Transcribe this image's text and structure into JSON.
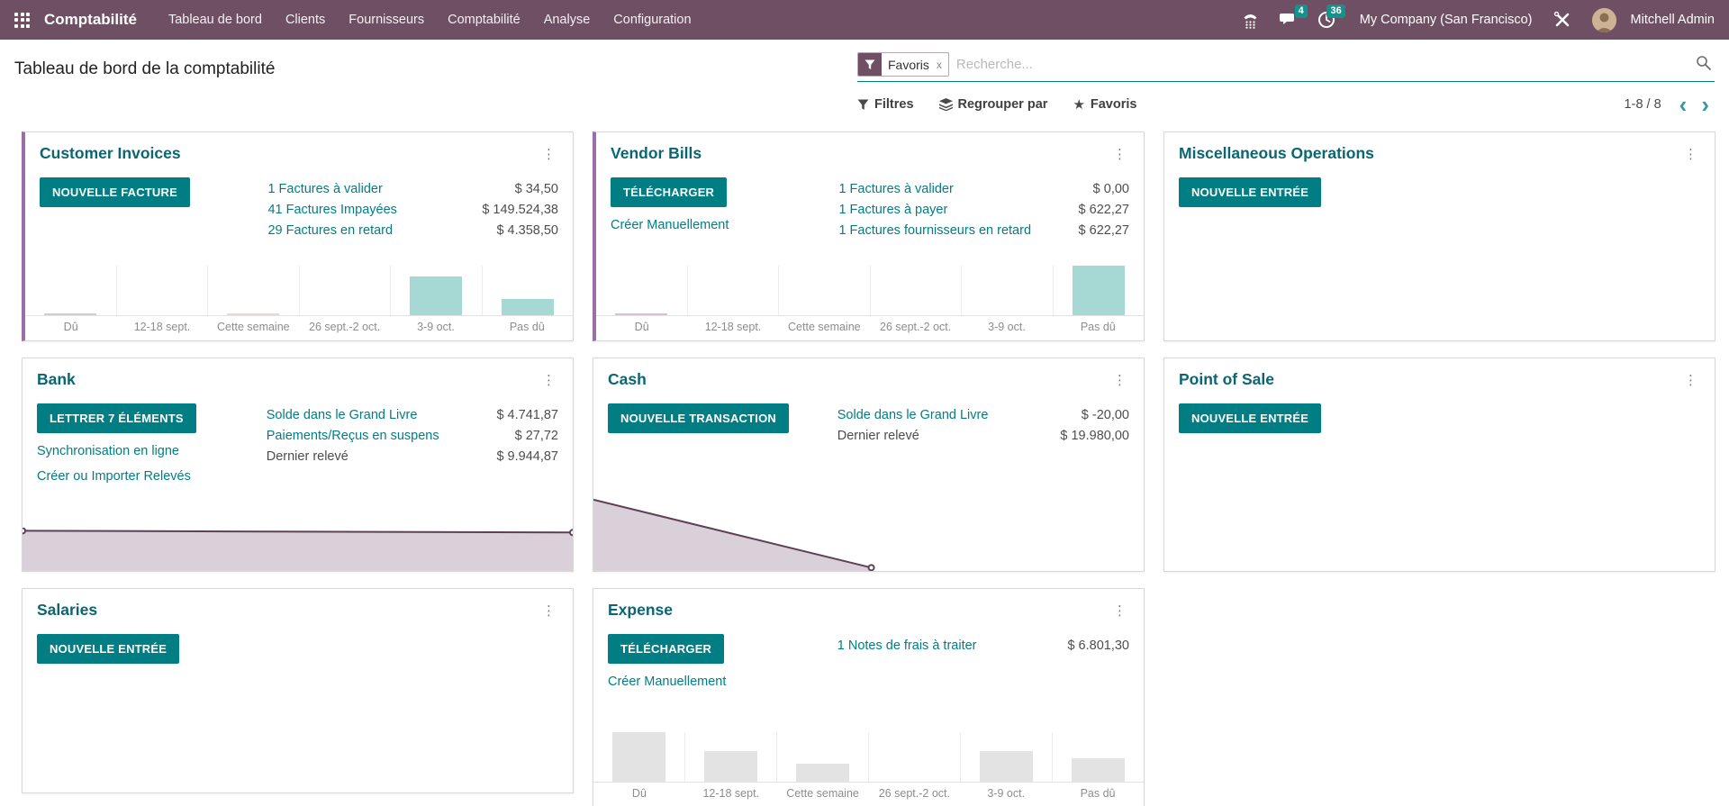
{
  "app": {
    "name": "Comptabilité",
    "menu": [
      "Tableau de bord",
      "Clients",
      "Fournisseurs",
      "Comptabilité",
      "Analyse",
      "Configuration"
    ],
    "systray": {
      "messages_badge": "4",
      "activities_badge": "36",
      "company": "My Company (San Francisco)",
      "user": "Mitchell Admin"
    }
  },
  "page": {
    "title": "Tableau de bord de la comptabilité",
    "search": {
      "facet_label": "Favoris",
      "facet_remove": "x",
      "placeholder": "Recherche..."
    },
    "controls": {
      "filters": "Filtres",
      "group_by": "Regrouper par",
      "favorites": "Favoris"
    },
    "pager": {
      "range": "1-8 / 8",
      "prev": "‹",
      "next": "›"
    }
  },
  "colors": {
    "navbar": "#6e4f64",
    "accent_teal": "#017e84",
    "card_stripe_purple": "#9a6fa8",
    "bar_teal": "#a6d9d4",
    "bar_gray": "#e3e3e3",
    "line_purple": "#5c4156",
    "area_fill": "#d9d0d9"
  },
  "cards": [
    {
      "id": "customer_invoices",
      "title": "Customer Invoices",
      "accent": true,
      "button": "NOUVELLE FACTURE",
      "links": [],
      "stats": [
        {
          "label": "1 Factures à valider",
          "value": "$ 34,50",
          "link": true
        },
        {
          "label": "41 Factures Impayées",
          "value": "$ 149.524,38",
          "link": true
        },
        {
          "label": "29 Factures en retard",
          "value": "$ 4.358,50",
          "link": true
        }
      ],
      "chart": {
        "type": "bar",
        "categories": [
          "Dû",
          "12-18 sept.",
          "Cette semaine",
          "26 sept.-2 oct.",
          "3-9 oct.",
          "Pas dû"
        ],
        "values": [
          0.04,
          0,
          0.02,
          0,
          0.78,
          0.33
        ],
        "bar_colors": [
          "#cfcfcf",
          null,
          "#e9d7d4",
          null,
          "#a6d9d4",
          "#a6d9d4"
        ]
      }
    },
    {
      "id": "vendor_bills",
      "title": "Vendor Bills",
      "accent": true,
      "button": "TÉLÉCHARGER",
      "links": [
        "Créer Manuellement"
      ],
      "stats": [
        {
          "label": "1 Factures à valider",
          "value": "$ 0,00",
          "link": true
        },
        {
          "label": "1 Factures à payer",
          "value": "$ 622,27",
          "link": true
        },
        {
          "label": "1 Factures fournisseurs en retard",
          "value": "$ 622,27",
          "link": true
        }
      ],
      "chart": {
        "type": "bar",
        "categories": [
          "Dû",
          "12-18 sept.",
          "Cette semaine",
          "26 sept.-2 oct.",
          "3-9 oct.",
          "Pas dû"
        ],
        "values": [
          0.04,
          0,
          0,
          0,
          0,
          1.0
        ],
        "bar_colors": [
          "#d3c0d1",
          null,
          null,
          null,
          null,
          "#a6d9d4"
        ]
      }
    },
    {
      "id": "miscellaneous_operations",
      "title": "Miscellaneous Operations",
      "accent": false,
      "button": "NOUVELLE ENTRÉE",
      "links": [],
      "stats": []
    },
    {
      "id": "bank",
      "title": "Bank",
      "accent": false,
      "button": "LETTRER 7 ÉLÉMENTS",
      "links": [
        "Synchronisation en ligne",
        "Créer ou Importer Relevés"
      ],
      "stats": [
        {
          "label": "Solde dans le Grand Livre",
          "value": "$ 4.741,87",
          "link": true
        },
        {
          "label": "Paiements/Reçus en suspens",
          "value": "$ 27,72",
          "link": true
        },
        {
          "label": "Dernier relevé",
          "value": "$ 9.944,87",
          "link": false
        }
      ],
      "chart": {
        "type": "area",
        "points": [
          [
            0,
            0.07
          ],
          [
            1,
            0.11
          ]
        ],
        "markers": [
          [
            0,
            0.07
          ],
          [
            1,
            0.11
          ]
        ],
        "height": 48,
        "stroke": "#5c4156",
        "fill": "#d9d0d9"
      }
    },
    {
      "id": "cash",
      "title": "Cash",
      "accent": false,
      "button": "NOUVELLE TRANSACTION",
      "links": [],
      "stats": [
        {
          "label": "Solde dans le Grand Livre",
          "value": "$ -20,00",
          "link": true
        },
        {
          "label": "Dernier relevé",
          "value": "$ 19.980,00",
          "link": false
        }
      ],
      "chart": {
        "type": "area",
        "points": [
          [
            0,
            0.14
          ],
          [
            0.505,
            0.96
          ]
        ],
        "markers": [
          [
            0.505,
            0.96
          ]
        ],
        "height": 92,
        "stroke": "#5c4156",
        "fill": "#d9d0d9"
      }
    },
    {
      "id": "point_of_sale",
      "title": "Point of Sale",
      "accent": false,
      "button": "NOUVELLE ENTRÉE",
      "links": [],
      "stats": []
    },
    {
      "id": "salaries",
      "title": "Salaries",
      "accent": false,
      "button": "NOUVELLE ENTRÉE",
      "links": [],
      "stats": []
    },
    {
      "id": "expense",
      "title": "Expense",
      "accent": false,
      "button": "TÉLÉCHARGER",
      "links": [
        "Créer Manuellement"
      ],
      "stats": [
        {
          "label": "1 Notes de frais à traiter",
          "value": "$ 6.801,30",
          "link": true
        }
      ],
      "chart": {
        "type": "bar",
        "categories": [
          "Dû",
          "12-18 sept.",
          "Cette semaine",
          "26 sept.-2 oct.",
          "3-9 oct.",
          "Pas dû"
        ],
        "values": [
          1.0,
          0.62,
          0.37,
          0,
          0.62,
          0.48
        ],
        "bar_colors": [
          "#e3e3e3",
          "#e3e3e3",
          "#e3e3e3",
          null,
          "#e3e3e3",
          "#e3e3e3"
        ]
      }
    }
  ]
}
